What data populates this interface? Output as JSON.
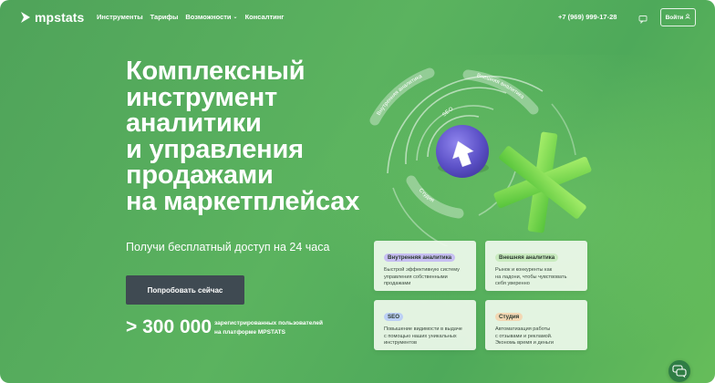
{
  "colors": {
    "background_green": "#56ab5c",
    "cta_dark": "#3f4a52",
    "card_bg": "#eef9ec",
    "badge_violet": "#c7bff2",
    "badge_lightgreen": "#c9ebbf",
    "badge_blue": "#bcd0f5",
    "badge_orange": "#f3d8b4",
    "asterisk_green": "#7fdc4a",
    "sphere_violet": "#6a5ed1"
  },
  "header": {
    "logo_text": "mpstats",
    "nav": [
      {
        "label": "Инструменты",
        "icon": null
      },
      {
        "label": "Тарифы",
        "icon": null
      },
      {
        "label": "Возможности",
        "icon": "chevron-down-icon"
      },
      {
        "label": "Консалтинг",
        "icon": null
      }
    ],
    "phone": "+7 (969) 999-17-28",
    "chat_icon": "chat-icon",
    "login_label": "Войти",
    "login_icon": "user-icon"
  },
  "hero": {
    "title_lines": [
      "Комплексный",
      "инструмент",
      "аналитики",
      "и управления",
      "продажами",
      "на маркетплейсах"
    ],
    "subtitle": "Получи бесплатный доступ на 24 часа",
    "cta_label": "Попробовать сейчас",
    "stat_number": "> 300 000",
    "stat_caption_lines": [
      "зарегистрированных пользователей",
      "на платформе MPSTATS"
    ]
  },
  "illustration": {
    "orbit_labels": [
      "Внутренняя аналитика",
      "Внешняя аналитика",
      "SEO",
      "Студия"
    ],
    "center_icon": "arrow-up-icon"
  },
  "cards": [
    {
      "badge": "Внутренняя аналитика",
      "badge_color": "#c7bff2",
      "text_lines": [
        "Быстрой эффективную систему",
        "управления собственными",
        "продажами"
      ]
    },
    {
      "badge": "Внешняя аналитика",
      "badge_color": "#c9ebbf",
      "text_lines": [
        "Рынок и конкуренты как",
        "на ладони, чтобы чувствовать",
        "себя уверенно"
      ]
    },
    {
      "badge": "SEO",
      "badge_color": "#bcd0f5",
      "text_lines": [
        "Повышение видимости в выдаче",
        "с помощью наших уникальных",
        "инструментов"
      ]
    },
    {
      "badge": "Студия",
      "badge_color": "#f3d8b4",
      "text_lines": [
        "Автоматизация работы",
        "с отзывами и рекламой.",
        "Экономь время и деньги"
      ]
    }
  ],
  "support_chat_icon": "support-chat-icon"
}
